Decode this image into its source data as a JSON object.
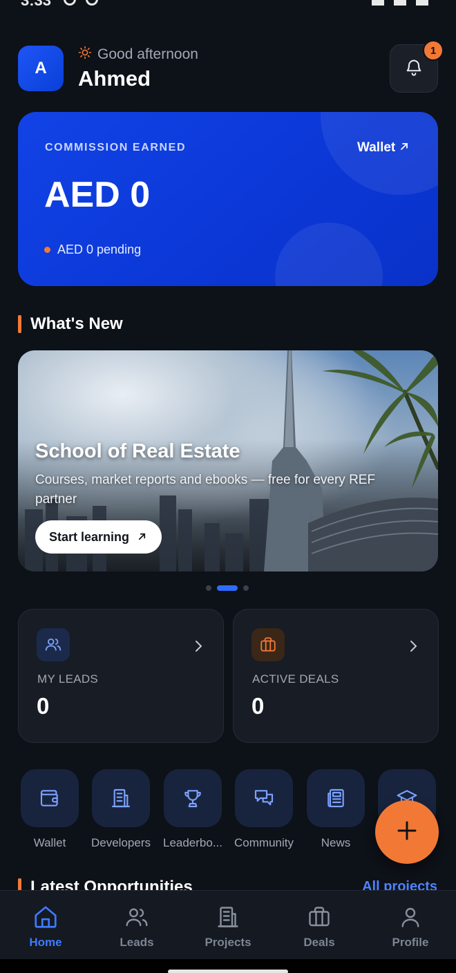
{
  "status_bar": {
    "time": "3:33"
  },
  "header": {
    "avatar_initial": "A",
    "greeting": "Good afternoon",
    "user_name": "Ahmed",
    "notification_count": "1"
  },
  "commission": {
    "label": "COMMISSION EARNED",
    "wallet_link": "Wallet",
    "amount": "AED 0",
    "pending": "AED 0 pending"
  },
  "whats_new": {
    "title": "What's New",
    "banner": {
      "title": "School of Real Estate",
      "description": "Courses, market reports and ebooks — free for every REF partner",
      "button": "Start learning"
    },
    "page_count": 3,
    "active_page": 2
  },
  "stats": {
    "leads": {
      "label": "MY LEADS",
      "value": "0"
    },
    "deals": {
      "label": "ACTIVE DEALS",
      "value": "0"
    }
  },
  "quick_actions": [
    {
      "label": "Wallet",
      "icon": "wallet-icon"
    },
    {
      "label": "Developers",
      "icon": "building-icon"
    },
    {
      "label": "Leaderbo...",
      "icon": "trophy-icon"
    },
    {
      "label": "Community",
      "icon": "chat-icon"
    },
    {
      "label": "News",
      "icon": "newspaper-icon"
    },
    {
      "label": "",
      "icon": "graduation-cap-icon"
    }
  ],
  "latest": {
    "title": "Latest Opportunities",
    "link": "All projects"
  },
  "bottom_nav": [
    {
      "label": "Home",
      "icon": "home-icon",
      "active": true
    },
    {
      "label": "Leads",
      "icon": "users-icon",
      "active": false
    },
    {
      "label": "Projects",
      "icon": "building-icon",
      "active": false
    },
    {
      "label": "Deals",
      "icon": "briefcase-icon",
      "active": false
    },
    {
      "label": "Profile",
      "icon": "user-icon",
      "active": false
    }
  ],
  "colors": {
    "background": "#0d1118",
    "accent_blue": "#2f6bff",
    "accent_orange": "#f27935",
    "card": "#171c25"
  }
}
